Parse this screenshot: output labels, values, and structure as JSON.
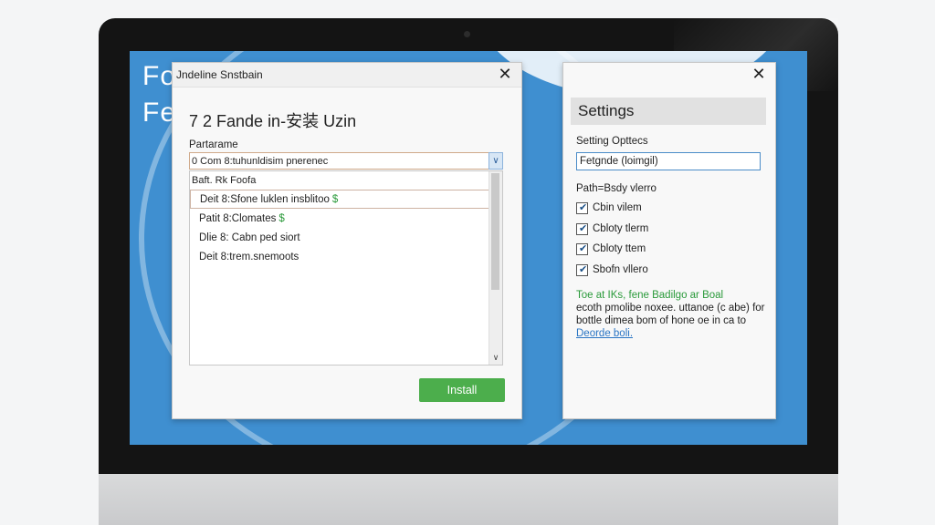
{
  "background": {
    "text_line1": "Fo",
    "text_line2": "Fe"
  },
  "installer": {
    "title": "Jndeline Snstbain",
    "heading": "7 2 Fande in-安装 Uzin",
    "field_label": "Partarame",
    "combo_value": "0 Com 8:tuhunldisim pnerenec",
    "combo_arrow_icon": "chevron-down-icon",
    "list_header": "Baft. Rk Foofa",
    "items": [
      {
        "label": "Deit 8:Sfone luklen insblitoo",
        "status": "$"
      },
      {
        "label": "Patit 8:Clomates",
        "status": "$"
      },
      {
        "label": "Dlie 8: Cabn ped siort",
        "status": ""
      },
      {
        "label": "Deit 8:trem.snemoots",
        "status": ""
      }
    ],
    "install_label": "Install"
  },
  "settings": {
    "title": "Settings",
    "options_label": "Setting Opttecs",
    "input_value": "Fetgnde (loimgil)",
    "path_label": "Path=Bsdy vlerro",
    "checkboxes": [
      {
        "label": "Cbin vilem",
        "checked": true
      },
      {
        "label": "Cbloty tlerm",
        "checked": true
      },
      {
        "label": "Cbloty ttem",
        "checked": true
      },
      {
        "label": "Sbofn vllero",
        "checked": true
      }
    ],
    "info_line1": "Toe at IKs, fene Badilgo ar Boal",
    "info_line2": "ecoth pmolibe noxee. uttanoe (c abe) for",
    "info_line3": "bottle dimea bom of hone oe in ca to",
    "info_link": "Deorde boli."
  },
  "colors": {
    "screen_bg": "#3f8fd0",
    "install_button": "#4cae4c",
    "status_green": "#2a9a3a",
    "link_blue": "#2a75c4"
  }
}
